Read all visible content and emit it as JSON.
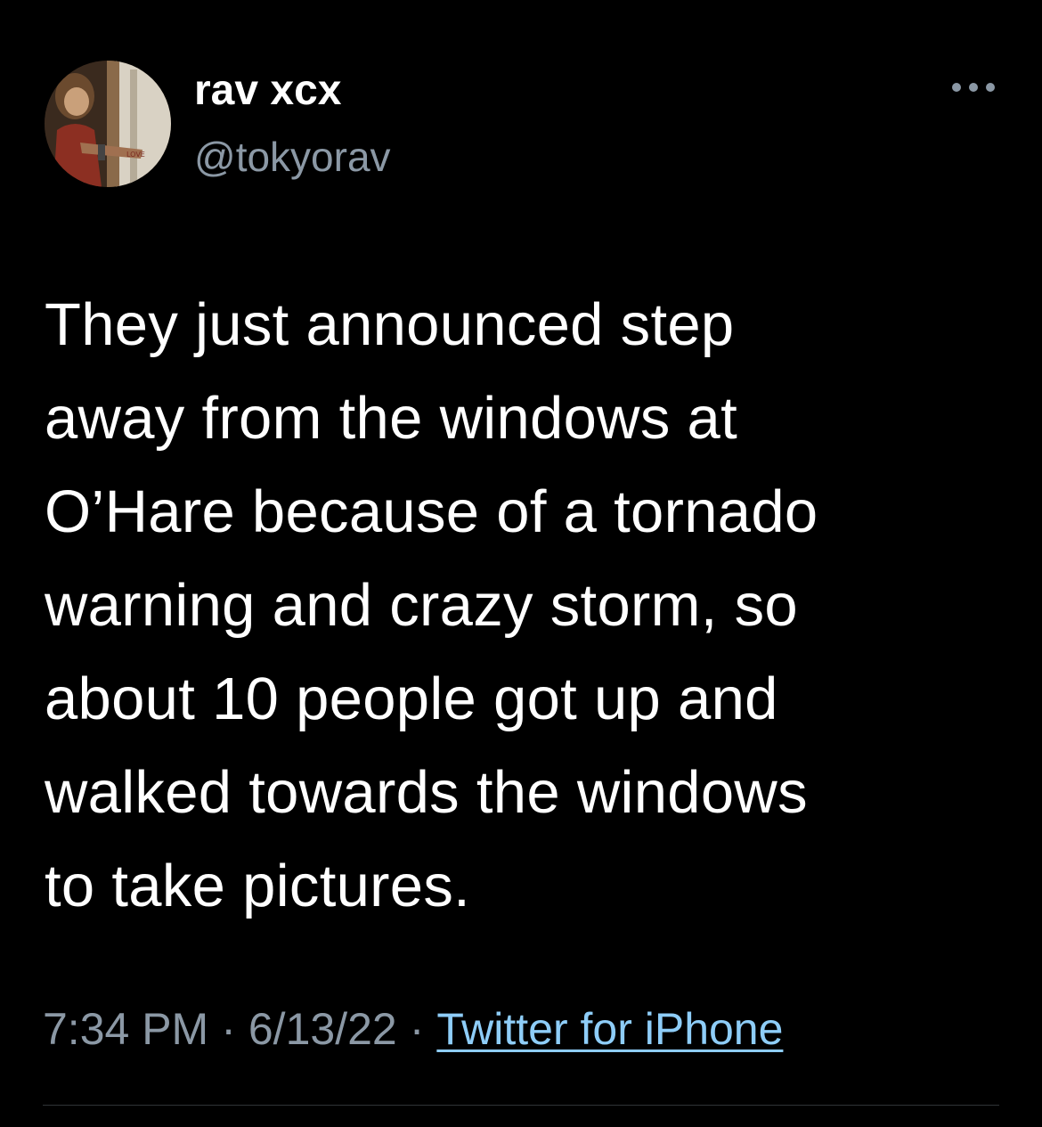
{
  "colors": {
    "background": "#000000",
    "text_primary": "#ffffff",
    "text_secondary": "#8b98a5",
    "link": "#8ecdf8",
    "divider": "#2f3336"
  },
  "author": {
    "display_name": "rav xcx",
    "handle": "@tokyorav",
    "avatar_icon": "profile-photo"
  },
  "more_icon": "ellipsis-icon",
  "tweet": {
    "text": "They just announced step\naway from the windows at\nO’Hare because of a tornado\nwarning and crazy storm, so\nabout 10 people got up and\nwalked towards the windows\nto take pictures."
  },
  "meta": {
    "time": "7:34 PM",
    "separator": "·",
    "date": "6/13/22",
    "source": "Twitter for iPhone"
  }
}
